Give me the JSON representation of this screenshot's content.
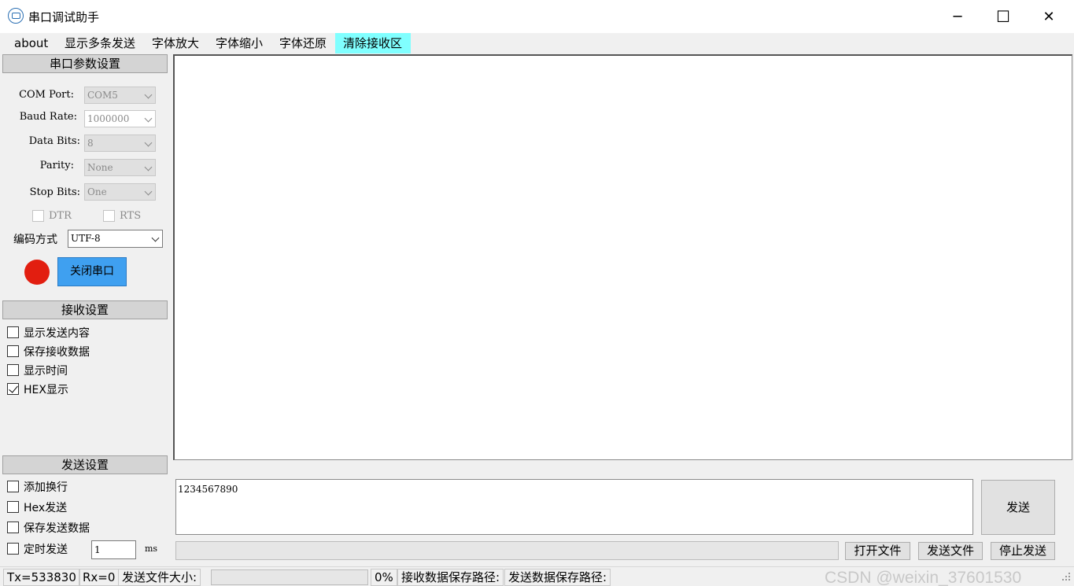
{
  "window": {
    "title": "串口调试助手",
    "controls": [
      "─",
      "☐",
      "✕"
    ]
  },
  "menu": [
    "about",
    "显示多条发送",
    "字体放大",
    "字体缩小",
    "字体还原",
    "清除接收区"
  ],
  "serial": {
    "header": "串口参数设置",
    "com_port_label": "COM Port:",
    "com_port_value": "COM5",
    "baud_label": "Baud Rate:",
    "baud_value": "1000000",
    "databits_label": "Data Bits:",
    "databits_value": "8",
    "parity_label": "Parity:",
    "parity_value": "None",
    "stopbits_label": "Stop Bits:",
    "stopbits_value": "One",
    "dtr_label": "DTR",
    "rts_label": "RTS",
    "encoding_label": "编码方式",
    "encoding_value": "UTF-8",
    "port_state_color": "#e21e10",
    "close_button": "关闭串口"
  },
  "receive": {
    "header": "接收设置",
    "options": [
      {
        "label": "显示发送内容",
        "checked": false
      },
      {
        "label": "保存接收数据",
        "checked": false
      },
      {
        "label": "显示时间",
        "checked": false
      },
      {
        "label": "HEX显示",
        "checked": true
      }
    ]
  },
  "send_settings": {
    "header": "发送设置",
    "options": [
      {
        "label": "添加换行",
        "checked": false
      },
      {
        "label": "Hex发送",
        "checked": false
      },
      {
        "label": "保存发送数据",
        "checked": false
      },
      {
        "label": "定时发送",
        "checked": false
      }
    ],
    "timer_value": "1",
    "timer_unit": "ms"
  },
  "send": {
    "text": "1234567890",
    "send_button": "发送",
    "open_file": "打开文件",
    "send_file": "发送文件",
    "stop_send": "停止发送"
  },
  "status": {
    "tx": "Tx=533830",
    "rx": "Rx=0",
    "file_size_label": "发送文件大小:",
    "percent": "0%",
    "recv_path_label": "接收数据保存路径:",
    "send_path_label": "发送数据保存路径:"
  },
  "watermark": "CSDN @weixin_37601530"
}
